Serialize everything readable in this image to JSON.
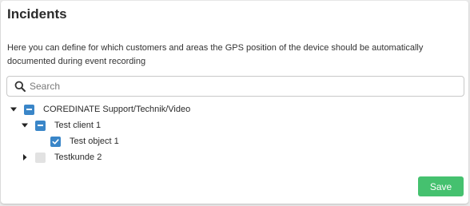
{
  "panel": {
    "title": "Incidents",
    "description": "Here you can define for which customers and areas the GPS position of the device should be automatically documented during event recording"
  },
  "search": {
    "placeholder": "Search",
    "value": "",
    "icon": "search-icon"
  },
  "tree": {
    "items": [
      {
        "label": "COREDINATE Support/Technik/Video",
        "expanded": true,
        "state": "partial"
      },
      {
        "label": "Test client 1",
        "expanded": true,
        "state": "partial"
      },
      {
        "label": "Test object 1",
        "state": "checked"
      },
      {
        "label": "Testkunde 2",
        "expanded": false,
        "state": "unchecked"
      }
    ]
  },
  "actions": {
    "save_label": "Save"
  },
  "colors": {
    "accent": "#3a86c8",
    "save": "#45c16f",
    "unchecked": "#e2e2e2"
  }
}
